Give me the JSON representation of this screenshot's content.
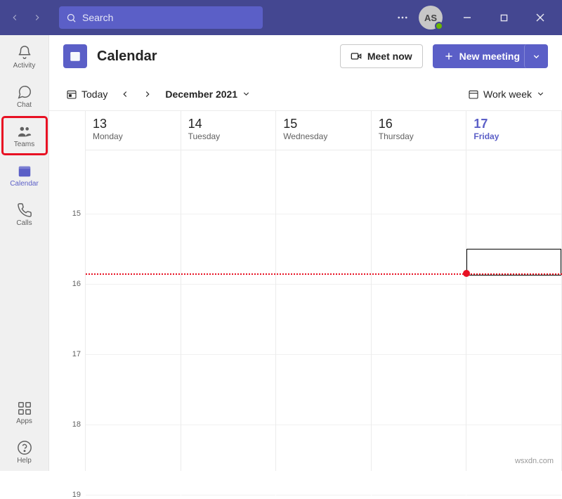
{
  "titlebar": {
    "search_placeholder": "Search",
    "avatar_initials": "AS"
  },
  "rail": {
    "items": [
      {
        "label": "Activity"
      },
      {
        "label": "Chat"
      },
      {
        "label": "Teams"
      },
      {
        "label": "Calendar"
      },
      {
        "label": "Calls"
      }
    ],
    "apps_label": "Apps",
    "help_label": "Help"
  },
  "header": {
    "title": "Calendar",
    "meet_now": "Meet now",
    "new_meeting": "New meeting"
  },
  "toolbar": {
    "today": "Today",
    "month": "December 2021",
    "view": "Work week"
  },
  "calendar": {
    "days": [
      {
        "num": "13",
        "name": "Monday"
      },
      {
        "num": "14",
        "name": "Tuesday"
      },
      {
        "num": "15",
        "name": "Wednesday"
      },
      {
        "num": "16",
        "name": "Thursday"
      },
      {
        "num": "17",
        "name": "Friday"
      }
    ],
    "hours": [
      "15",
      "16",
      "17",
      "18",
      "19"
    ]
  },
  "watermark": "wsxdn.com"
}
